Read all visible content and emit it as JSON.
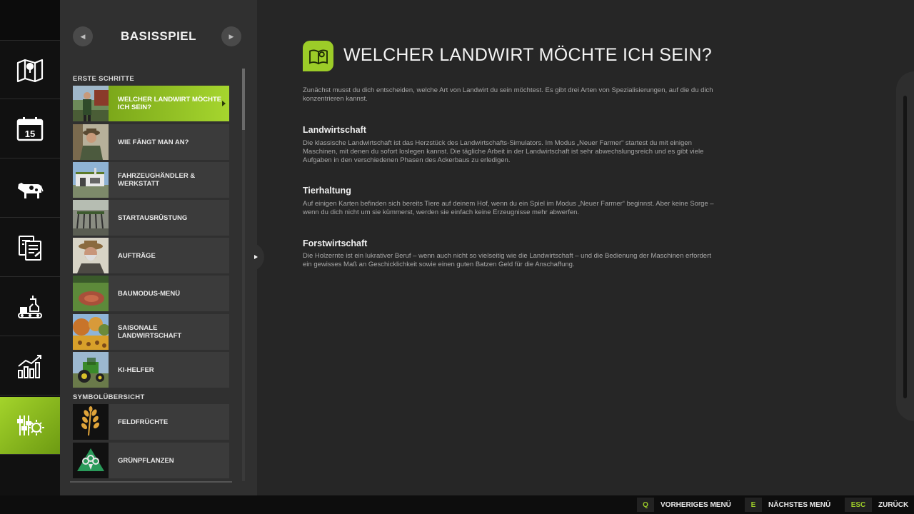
{
  "rail": {
    "items": [
      {
        "name": "map-icon"
      },
      {
        "name": "calendar-icon",
        "day": "15"
      },
      {
        "name": "cow-icon"
      },
      {
        "name": "contracts-icon"
      },
      {
        "name": "production-icon"
      },
      {
        "name": "statistics-icon"
      },
      {
        "name": "help-settings-icon",
        "active": true
      }
    ]
  },
  "list": {
    "title": "BASISSPIEL",
    "sections": [
      {
        "label": "ERSTE SCHRITTE",
        "items": [
          {
            "label": "WELCHER LANDWIRT MÖCHTE ICH SEIN?",
            "active": true,
            "thumb": "farmer-thumb"
          },
          {
            "label": "WIE FÄNGT MAN AN?",
            "thumb": "farmer-portrait-thumb"
          },
          {
            "label": "FAHRZEUGHÄNDLER & WERKSTATT",
            "thumb": "dealer-thumb"
          },
          {
            "label": "STARTAUSRÜSTUNG",
            "thumb": "equipment-thumb"
          },
          {
            "label": "AUFTRÄGE",
            "thumb": "old-farmer-thumb"
          },
          {
            "label": "BAUMODUS-MENÜ",
            "thumb": "field-thumb"
          },
          {
            "label": "SAISONALE LANDWIRTSCHAFT",
            "thumb": "autumn-thumb"
          },
          {
            "label": "KI-HELFER",
            "thumb": "tractor-thumb"
          }
        ]
      },
      {
        "label": "SYMBOLÜBERSICHT",
        "items": [
          {
            "label": "FELDFRÜCHTE",
            "thumb": "wheat-icon"
          },
          {
            "label": "GRÜNPFLANZEN",
            "thumb": "broccoli-icon"
          }
        ]
      }
    ]
  },
  "content": {
    "title": "WELCHER LANDWIRT MÖCHTE ICH SEIN?",
    "intro": "Zunächst musst du dich entscheiden, welche Art von Landwirt du sein möchtest. Es gibt drei Arten von Spezialisierungen, auf die du dich konzentrieren kannst.",
    "sections": [
      {
        "heading": "Landwirtschaft",
        "text": "Die klassische Landwirtschaft ist das Herzstück des Landwirtschafts-Simulators. Im Modus „Neuer Farmer“ startest du mit einigen Maschinen, mit denen du sofort loslegen kannst. Die tägliche Arbeit in der Landwirtschaft ist sehr abwechslungsreich und es gibt viele Aufgaben in den verschiedenen Phasen des Ackerbaus zu erledigen."
      },
      {
        "heading": "Tierhaltung",
        "text": "Auf einigen Karten befinden sich bereits Tiere auf deinem Hof, wenn du ein Spiel im Modus „Neuer Farmer“ beginnst. Aber keine Sorge – wenn du dich nicht um sie kümmerst, werden sie einfach keine Erzeugnisse mehr abwerfen."
      },
      {
        "heading": "Forstwirtschaft",
        "text": "Die Holzernte ist ein lukrativer Beruf – wenn auch nicht so vielseitig wie die Landwirtschaft – und die Bedienung der Maschinen erfordert ein gewisses Maß an Geschicklichkeit sowie einen guten Batzen Geld für die Anschaffung."
      }
    ]
  },
  "footer": {
    "hints": [
      {
        "key": "Q",
        "label": "VORHERIGES MENÜ"
      },
      {
        "key": "E",
        "label": "NÄCHSTES MENÜ"
      },
      {
        "key": "ESC",
        "label": "ZURÜCK"
      }
    ]
  },
  "colors": {
    "accent": "#9ccc28",
    "panel": "#303030",
    "background": "#262626"
  }
}
